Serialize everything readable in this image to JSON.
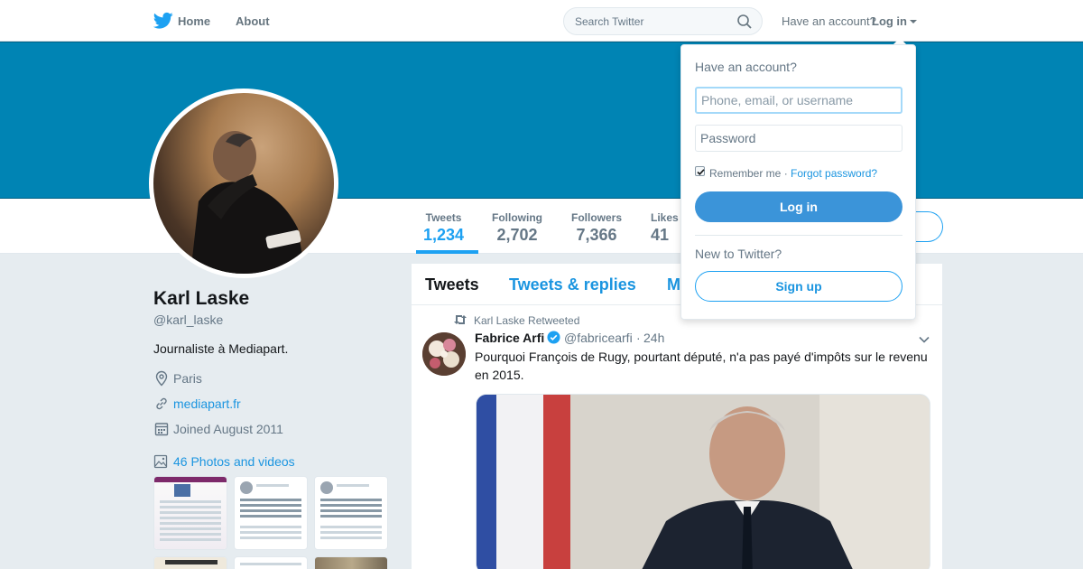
{
  "nav": {
    "home_label": "Home",
    "about_label": "About",
    "search_placeholder": "Search Twitter",
    "have_account_label": "Have an account?",
    "login_label": "Log in"
  },
  "profile": {
    "name": "Karl Laske",
    "handle": "@karl_laske",
    "bio": "Journaliste à Mediapart.",
    "location": "Paris",
    "website": "mediapart.fr",
    "joined": "Joined August 2011",
    "photos_label": "46 Photos and videos"
  },
  "stats": [
    {
      "label": "Tweets",
      "value": "1,234",
      "active": true
    },
    {
      "label": "Following",
      "value": "2,702",
      "active": false
    },
    {
      "label": "Followers",
      "value": "7,366",
      "active": false
    },
    {
      "label": "Likes",
      "value": "41",
      "active": false
    }
  ],
  "timeline": {
    "tabs": [
      {
        "label": "Tweets",
        "active": true
      },
      {
        "label": "Tweets & replies",
        "active": false
      },
      {
        "label": "M",
        "active": false
      }
    ],
    "tweet": {
      "retweet_context": "Karl Laske Retweeted",
      "author_name": "Fabrice Arfi",
      "author_handle": "@fabricearfi",
      "separator": "·",
      "time": "24h",
      "text": "Pourquoi François de Rugy, pourtant député, n'a pas payé d'impôts sur le revenu en 2015."
    }
  },
  "login_dropdown": {
    "title": "Have an account?",
    "username_placeholder": "Phone, email, or username",
    "password_placeholder": "Password",
    "remember_label": "Remember me ·",
    "forgot_label": "Forgot password?",
    "login_button": "Log in",
    "new_label": "New to Twitter?",
    "signup_button": "Sign up"
  },
  "colors": {
    "brand_blue": "#1da1f2",
    "banner": "#0084b4",
    "link": "#1b95e0"
  },
  "icons": [
    "twitter-bird-icon",
    "search-icon",
    "location-icon",
    "link-icon",
    "calendar-icon",
    "photo-icon",
    "retweet-icon",
    "verified-icon",
    "chevron-down-icon"
  ]
}
